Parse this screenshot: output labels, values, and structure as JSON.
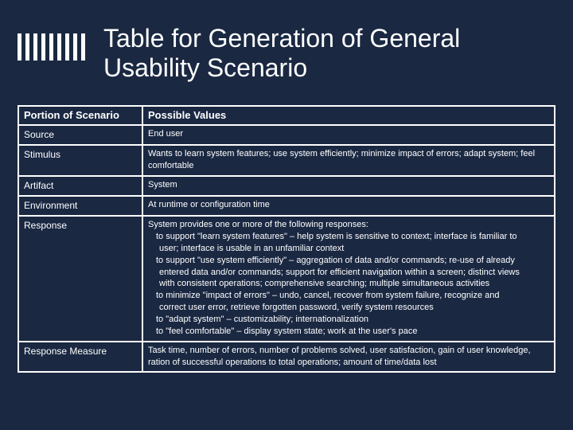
{
  "title": "Table for Generation of General Usability Scenario",
  "headers": {
    "col1": "Portion of Scenario",
    "col2": "Possible Values"
  },
  "rows": {
    "source": {
      "k": "Source",
      "v": "End user"
    },
    "stimulus": {
      "k": "Stimulus",
      "v": "Wants to learn system features; use system efficiently; minimize impact of errors; adapt system; feel comfortable"
    },
    "artifact": {
      "k": "Artifact",
      "v": "System"
    },
    "environment": {
      "k": "Environment",
      "v": "At runtime or configuration time"
    },
    "response": {
      "k": "Response",
      "lead": "System provides one or more of the following responses:",
      "items": [
        {
          "a": "to support \"learn system features\" – help system is sensitive to context; interface is familiar to",
          "b": "user; interface is usable in an unfamiliar context"
        },
        {
          "a": "to support \"use system efficiently\" – aggregation of data and/or commands; re-use of already",
          "b": "entered data and/or commands; support for efficient navigation within a screen; distinct views",
          "c": "with consistent operations; comprehensive searching; multiple simultaneous activities"
        },
        {
          "a": "to minimize \"impact of errors\" – undo, cancel, recover from system failure, recognize and",
          "b": "correct user error, retrieve forgotten password, verify system resources"
        },
        {
          "a": "to \"adapt system\" – customizability; internationalization"
        },
        {
          "a": "to \"feel comfortable\" – display system state; work at the user's pace"
        }
      ]
    },
    "measure": {
      "k": "Response Measure",
      "v": "Task time, number of errors, number of problems solved, user satisfaction, gain of user knowledge, ration of successful operations to total operations; amount of time/data lost"
    }
  }
}
